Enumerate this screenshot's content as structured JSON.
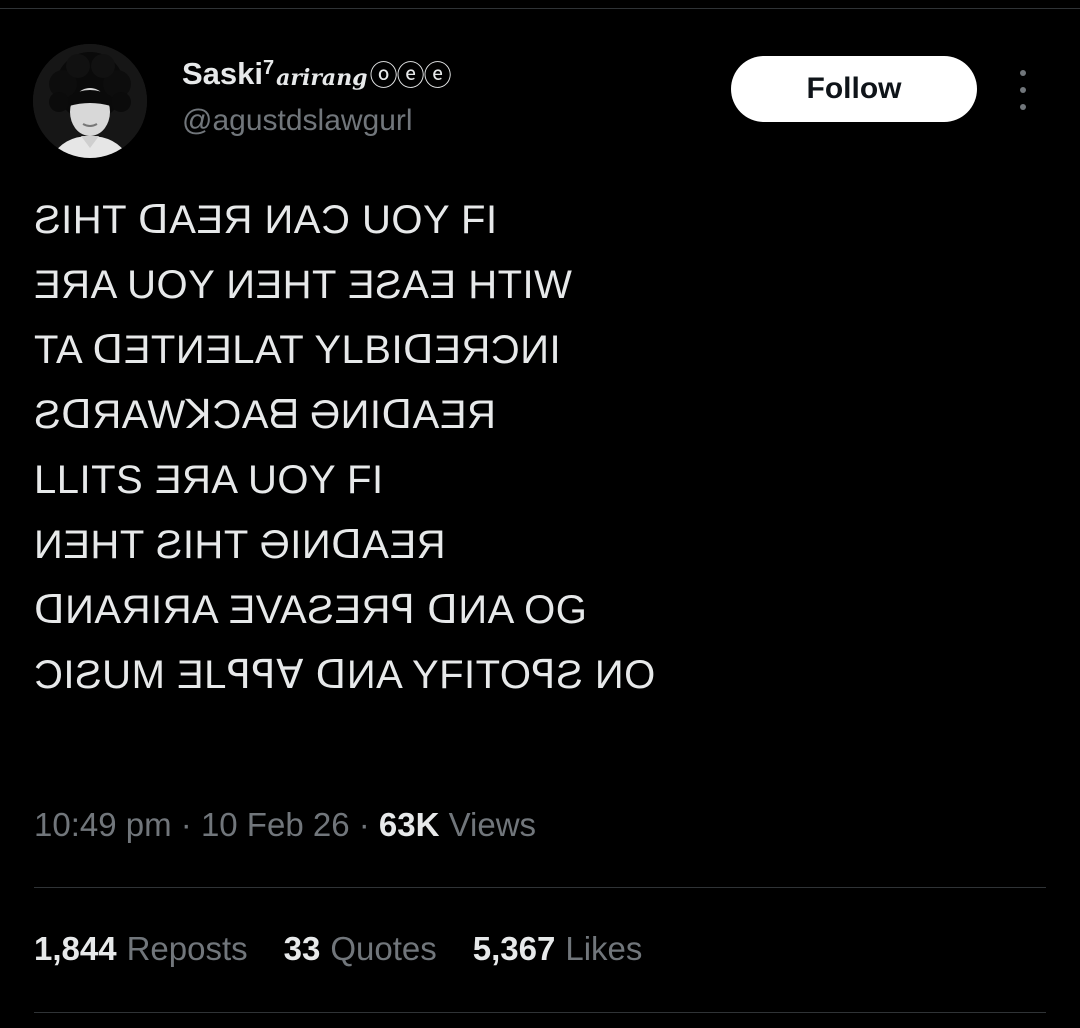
{
  "author": {
    "display_name": "Saski",
    "name_suffix": "7",
    "name_stylized": "arirang",
    "name_circled": "ⓞⓔⓔ",
    "handle": "@agustdslawgurl",
    "avatar": "profile-photo"
  },
  "actions": {
    "follow_label": "Follow",
    "more_icon": "vertical-ellipsis"
  },
  "tweet": {
    "lines": [
      "ƧIHT ᗡAƎЯ ИAƆ UOY FI",
      "ƎЯA UOY ИƎHT ƎƧAƎ HTIW",
      "TA ᗡƎTИƎLAT YLBIᗡƎЯƆИI",
      "ƧᗡЯAWꓘƆAᗺ ӘИIᗡAƎЯ",
      "LLITS ƎЯA UOY FI",
      "ИƎHT ƧIHT ӘIИᗡAƎЯ",
      "ᗡИAЯIЯA ƎVAƧƎЯꟼ ᗡИA OG",
      "ƆIƧUM ƎLꟼꟼ∀ ᗡИA YFITOꟼƧ ИO"
    ]
  },
  "meta": {
    "time": "10:49 pm",
    "separator": "·",
    "date": "10 Feb 26",
    "views_count": "63K",
    "views_label": "Views"
  },
  "stats": {
    "reposts_count": "1,844",
    "reposts_label": "Reposts",
    "quotes_count": "33",
    "quotes_label": "Quotes",
    "likes_count": "5,367",
    "likes_label": "Likes"
  },
  "colors": {
    "background": "#000000",
    "text_primary": "#e7e9ea",
    "text_secondary": "#71767b",
    "divider": "#2f3336",
    "follow_bg": "#ffffff"
  }
}
